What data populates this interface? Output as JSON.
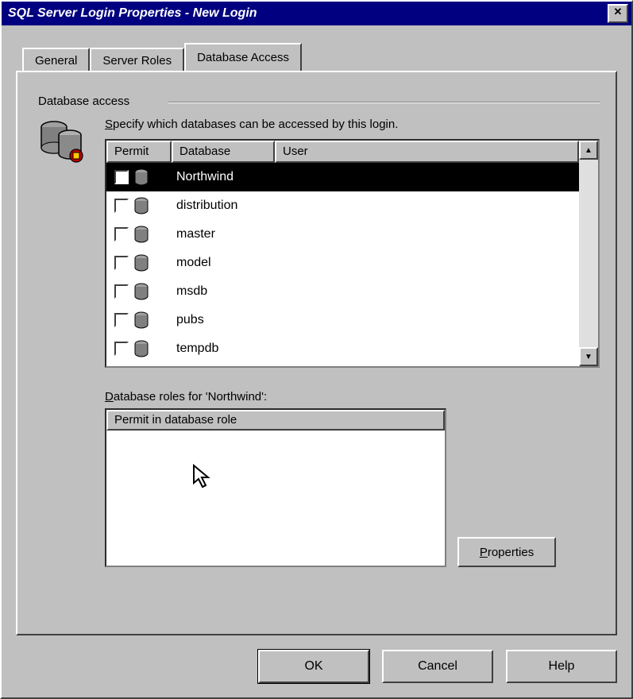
{
  "window": {
    "title": "SQL Server Login Properties - New Login",
    "close_glyph": "✕"
  },
  "tabs": {
    "general": "General",
    "server_roles": "Server Roles",
    "database_access": "Database Access"
  },
  "group_title": "Database access",
  "instruction_pre": "S",
  "instruction_rest": "pecify which databases can be accessed by this login.",
  "grid": {
    "headers": {
      "permit": "Permit",
      "database": "Database",
      "user": "User"
    },
    "rows": [
      {
        "db": "Northwind",
        "user": "",
        "checked": false,
        "selected": true
      },
      {
        "db": "distribution",
        "user": "",
        "checked": false,
        "selected": false
      },
      {
        "db": "master",
        "user": "",
        "checked": false,
        "selected": false
      },
      {
        "db": "model",
        "user": "",
        "checked": false,
        "selected": false
      },
      {
        "db": "msdb",
        "user": "",
        "checked": false,
        "selected": false
      },
      {
        "db": "pubs",
        "user": "",
        "checked": false,
        "selected": false
      },
      {
        "db": "tempdb",
        "user": "",
        "checked": false,
        "selected": false
      }
    ]
  },
  "roles": {
    "label_pre": "D",
    "label_rest": "atabase roles for 'Northwind':",
    "header": "Permit in database role"
  },
  "buttons": {
    "properties_pre": "P",
    "properties_rest": "roperties",
    "ok": "OK",
    "cancel": "Cancel",
    "help": "Help"
  }
}
